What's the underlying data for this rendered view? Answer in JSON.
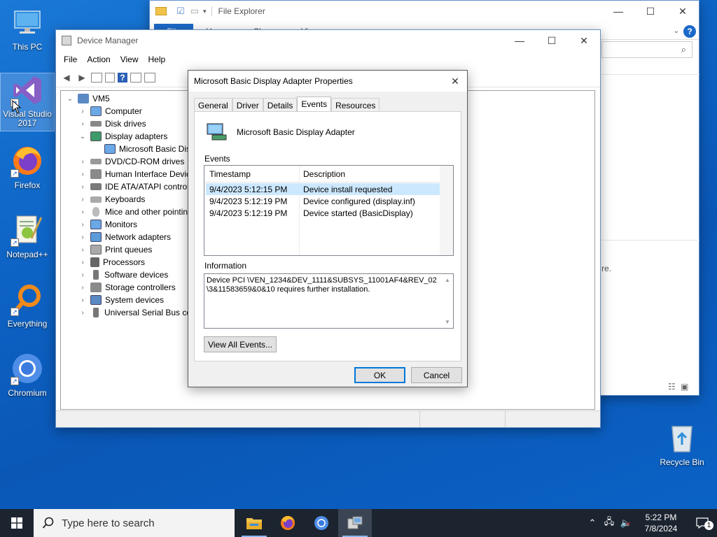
{
  "desktop": {
    "icons": [
      {
        "label": "This PC",
        "icon": "pc-icon"
      },
      {
        "label": "Visual Studio 2017",
        "icon": "visual-studio-icon"
      },
      {
        "label": "Firefox",
        "icon": "firefox-icon"
      },
      {
        "label": "Notepad++",
        "icon": "notepad-plus-plus-icon"
      },
      {
        "label": "Everything",
        "icon": "everything-search-icon"
      },
      {
        "label": "Chromium",
        "icon": "chromium-icon"
      },
      {
        "label": "Recycle Bin",
        "icon": "recycle-bin-icon"
      }
    ]
  },
  "explorer": {
    "title": "File Explorer",
    "ribbon_tabs": [
      "File",
      "Home",
      "Share",
      "View"
    ],
    "info_fragment": "re."
  },
  "device_manager": {
    "title": "Device Manager",
    "menu": [
      "File",
      "Action",
      "View",
      "Help"
    ],
    "root": "VM5",
    "categories": [
      {
        "label": "Computer",
        "expanded": false
      },
      {
        "label": "Disk drives",
        "expanded": false
      },
      {
        "label": "Display adapters",
        "expanded": true
      },
      {
        "label": "Microsoft Basic Disp",
        "child": true
      },
      {
        "label": "DVD/CD-ROM drives",
        "expanded": false
      },
      {
        "label": "Human Interface Devic",
        "expanded": false
      },
      {
        "label": "IDE ATA/ATAPI controlle",
        "expanded": false
      },
      {
        "label": "Keyboards",
        "expanded": false
      },
      {
        "label": "Mice and other pointin",
        "expanded": false
      },
      {
        "label": "Monitors",
        "expanded": false
      },
      {
        "label": "Network adapters",
        "expanded": false
      },
      {
        "label": "Print queues",
        "expanded": false
      },
      {
        "label": "Processors",
        "expanded": false
      },
      {
        "label": "Software devices",
        "expanded": false
      },
      {
        "label": "Storage controllers",
        "expanded": false
      },
      {
        "label": "System devices",
        "expanded": false
      },
      {
        "label": "Universal Serial Bus cor",
        "expanded": false
      }
    ]
  },
  "properties": {
    "title": "Microsoft Basic Display Adapter Properties",
    "tabs": [
      "General",
      "Driver",
      "Details",
      "Events",
      "Resources"
    ],
    "active_tab": "Events",
    "device_name": "Microsoft Basic Display Adapter",
    "events_label": "Events",
    "columns": [
      "Timestamp",
      "Description"
    ],
    "events": [
      {
        "timestamp": "9/4/2023 5:12:15 PM",
        "description": "Device install requested",
        "selected": true
      },
      {
        "timestamp": "9/4/2023 5:12:19 PM",
        "description": "Device configured (display.inf)",
        "selected": false
      },
      {
        "timestamp": "9/4/2023 5:12:19 PM",
        "description": "Device started (BasicDisplay)",
        "selected": false
      }
    ],
    "information_label": "Information",
    "information_text": "Device PCI \\VEN_1234&DEV_1111&SUBSYS_11001AF4&REV_02\\3&11583659&0&10 requires further installation.",
    "view_all_events": "View All Events...",
    "ok": "OK",
    "cancel": "Cancel"
  },
  "taskbar": {
    "search_placeholder": "Type here to search",
    "apps": [
      "file-explorer-icon",
      "firefox-icon",
      "chromium-icon",
      "device-manager-icon"
    ],
    "time": "5:22 PM",
    "date": "7/8/2024",
    "notification_count": "1"
  }
}
